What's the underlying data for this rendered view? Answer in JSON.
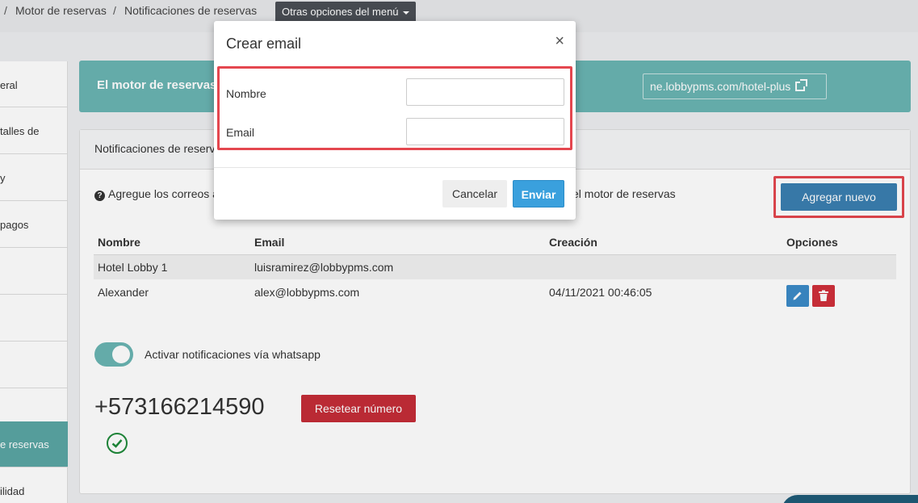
{
  "breadcrumb": {
    "sep1": "/",
    "item1": "Motor de reservas",
    "sep2": "/",
    "item2": "Notificaciones de reservas",
    "menu_label": "Otras opciones del menú"
  },
  "sidebar": {
    "items": [
      {
        "label": "eral"
      },
      {
        "label": "talles de"
      },
      {
        "label": "y"
      },
      {
        "label": "pagos"
      },
      {
        "label": "e reservas"
      },
      {
        "label": "ilidad"
      }
    ]
  },
  "banner": {
    "text": "El motor de reservas",
    "link": "ne.lobbypms.com/hotel-plus"
  },
  "panel": {
    "title": "Notificaciones de reserv",
    "help_left": "Agregue los correos a",
    "help_right": "el motor de reservas",
    "add_button": "Agregar nuevo",
    "table": {
      "headers": [
        "Nombre",
        "Email",
        "Creación",
        "Opciones"
      ],
      "rows": [
        {
          "nombre": "Hotel Lobby 1",
          "email": "luisramirez@lobbypms.com",
          "creacion": ""
        },
        {
          "nombre": "Alexander",
          "email": "alex@lobbypms.com",
          "creacion": "04/11/2021 00:46:05"
        }
      ]
    },
    "whatsapp_label": "Activar notificaciones vía whatsapp",
    "whatsapp_enabled": true,
    "phone": "+573166214590",
    "reset_button": "Resetear número"
  },
  "modal": {
    "title": "Crear email",
    "close": "×",
    "name_label": "Nombre",
    "name_value": "",
    "email_label": "Email",
    "email_value": "",
    "cancel": "Cancelar",
    "submit": "Enviar"
  },
  "colors": {
    "teal": "#6ab5b3",
    "primary": "#3a7fb0",
    "danger": "#c42d37",
    "highlight": "#e4474f"
  }
}
